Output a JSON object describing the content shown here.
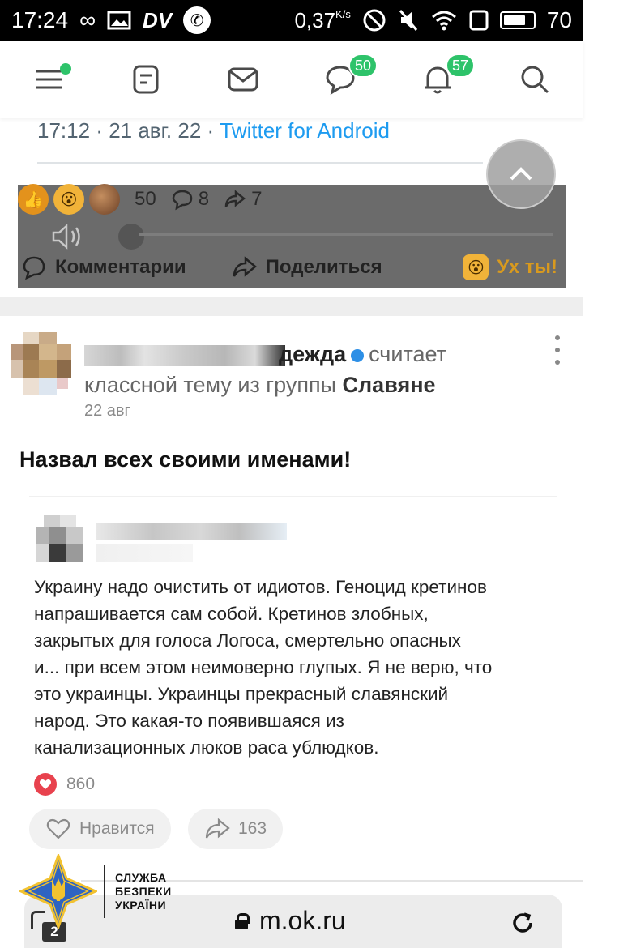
{
  "status_bar": {
    "time": "17:24",
    "infinity": "∞",
    "speed_value": "0,37",
    "speed_unit": "K/s",
    "battery": "70"
  },
  "nav": {
    "messages_badge": "50",
    "notifications_badge": "57"
  },
  "tweet": {
    "time": "17:12",
    "sep": " · ",
    "date": "21 авг. 22",
    "source": "Twitter for Android"
  },
  "overlay": {
    "reactions_count": "50",
    "comments_count": "8",
    "shares_count": "7",
    "comments_label": "Комментарии",
    "share_label": "Поделиться",
    "wow_label": "Ух ты!"
  },
  "post": {
    "author_name_visible": "дежда",
    "action_text": "считает классной тему из группы",
    "group_name": "Славяне",
    "date": "22 авг",
    "title": "Назвал всех своими именами!",
    "quote_lines": [
      "Украину надо очистить от идиотов. Геноцид кретинов",
      "напрашивается сам собой. Кретинов злобных,",
      "закрытых для голоса Логоса, смертельно опасных",
      "и... при всем этом неимоверно глупых. Я не верю, что",
      "это украинцы. Украинцы прекрасный славянский",
      "народ. Это какая-то появившаяся из",
      "канализационных люков раса ублюдков."
    ],
    "likes_count": "860",
    "like_button_label": "Нравится",
    "share_count": "163"
  },
  "browser": {
    "url": "m.ok.ru",
    "tabs_count": "2"
  },
  "watermark": {
    "line1": "СЛУЖБА",
    "line2": "БЕЗПЕКИ",
    "line3": "УКРАЇНИ"
  },
  "colors": {
    "accent_green": "#2ec36a",
    "twitter_blue": "#1d9bf0",
    "heart_red": "#e8424e",
    "wow_gold": "#d99a1e",
    "sbu_blue": "#2f64c2",
    "sbu_gold": "#f2c230"
  }
}
